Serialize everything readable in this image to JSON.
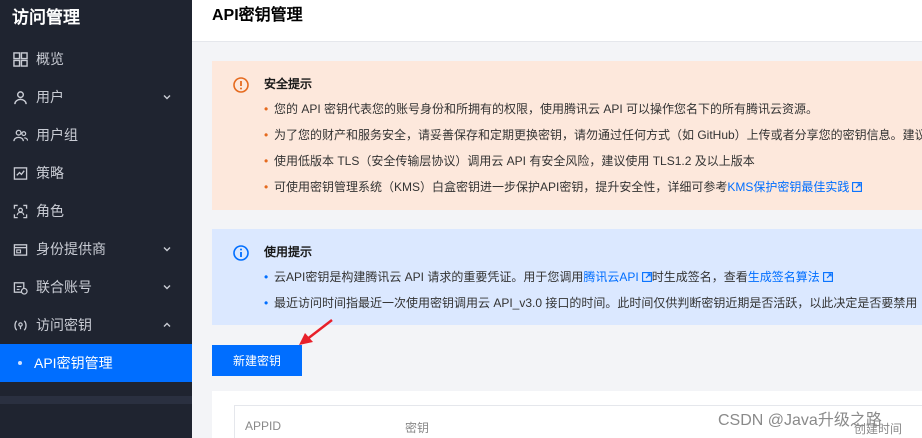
{
  "sidebar": {
    "title": "访问管理",
    "items": [
      {
        "label": "概览",
        "icon": "grid-icon",
        "has_chevron": false
      },
      {
        "label": "用户",
        "icon": "user-icon",
        "has_chevron": true
      },
      {
        "label": "用户组",
        "icon": "user-group-icon",
        "has_chevron": false
      },
      {
        "label": "策略",
        "icon": "policy-icon",
        "has_chevron": false
      },
      {
        "label": "角色",
        "icon": "role-icon",
        "has_chevron": false
      },
      {
        "label": "身份提供商",
        "icon": "identity-provider-icon",
        "has_chevron": true
      },
      {
        "label": "联合账号",
        "icon": "federated-account-icon",
        "has_chevron": true
      },
      {
        "label": "访问密钥",
        "icon": "access-key-icon",
        "has_chevron": true,
        "expanded": true
      }
    ],
    "active_sub": "API密钥管理"
  },
  "header": {
    "title": "API密钥管理"
  },
  "security_notice": {
    "title": "安全提示",
    "items": [
      "您的 API 密钥代表您的账号身份和所拥有的权限，使用腾讯云 API 可以操作您名下的所有腾讯云资源。",
      "为了您的财产和服务安全，请妥善保存和定期更换密钥，请勿通过任何方式（如 GitHub）上传或者分享您的密钥信息。建议",
      "使用低版本 TLS（安全传输层协议）调用云 API 有安全风险，建议使用 TLS1.2 及以上版本",
      "可使用密钥管理系统（KMS）白盒密钥进一步保护API密钥，提升安全性，详细可参考"
    ],
    "kms_link": "KMS保护密钥最佳实践"
  },
  "usage_notice": {
    "title": "使用提示",
    "line1_prefix": "云API密钥是构建腾讯云 API 请求的重要凭证。用于您调用",
    "line1_link1": "腾讯云API",
    "line1_middle": "时生成签名，查看",
    "line1_link2": "生成签名算法",
    "line2": "最近访问时间指最近一次使用密钥调用云 API_v3.0 接口的时间。此时间仅供判断密钥近期是否活跃，以此决定是否要禁用"
  },
  "create_button": "新建密钥",
  "table": {
    "columns": [
      "APPID",
      "密钥"
    ]
  },
  "watermark": "CSDN @Java升级之路",
  "watermark_tail": "创建时间",
  "colors": {
    "sidebar_bg": "#1f2430",
    "active": "#006eff",
    "warn_bg": "#fde8dc",
    "warn_icon": "#e56a1e",
    "info_bg": "#dbe8ff",
    "arrow": "#e8202a"
  }
}
